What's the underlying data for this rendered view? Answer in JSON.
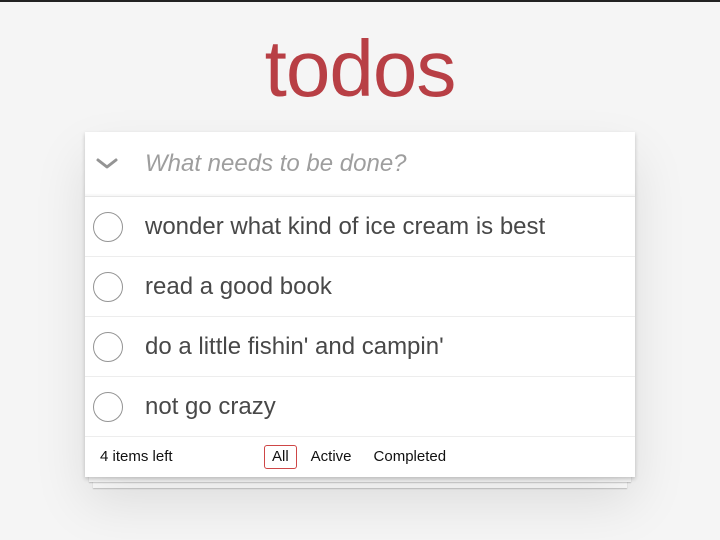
{
  "app": {
    "title": "todos"
  },
  "input": {
    "placeholder": "What needs to be done?",
    "value": ""
  },
  "todos": [
    {
      "label": "wonder what kind of ice cream is best",
      "completed": false
    },
    {
      "label": "read a good book",
      "completed": false
    },
    {
      "label": "do a little fishin' and campin'",
      "completed": false
    },
    {
      "label": "not go crazy",
      "completed": false
    }
  ],
  "footer": {
    "count_text": "4 items left",
    "filters": [
      {
        "label": "All",
        "selected": true
      },
      {
        "label": "Active",
        "selected": false
      },
      {
        "label": "Completed",
        "selected": false
      }
    ]
  },
  "colors": {
    "title": "#b83f45",
    "selected_filter_border": "#ce4646",
    "background": "#f5f5f5"
  },
  "icons": {
    "toggle_all": "chevron-down-icon"
  }
}
